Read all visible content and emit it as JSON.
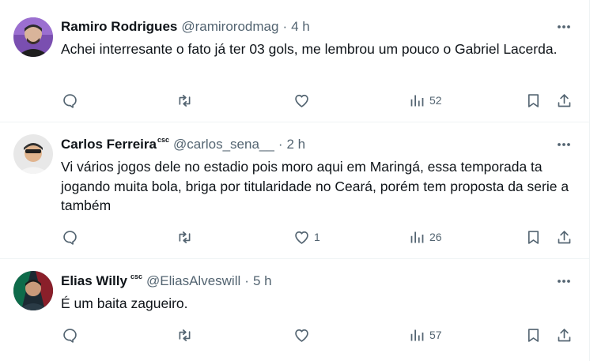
{
  "tweets": [
    {
      "name": "Ramiro Rodrigues",
      "badge": "",
      "handle": "@ramirorodmag",
      "separator": "·",
      "time": "4 h",
      "text": "Achei interresante o fato já ter 03 gols, me lembrou um pouco o Gabriel Lacerda.",
      "replies": "",
      "retweets": "",
      "likes": "",
      "views": "52"
    },
    {
      "name": "Carlos Ferreira",
      "badge": "csc",
      "handle": "@carlos_sena__",
      "separator": "·",
      "time": "2 h",
      "text": "Vi vários jogos dele no estadio pois moro aqui em Maringá, essa temporada ta jogando muita bola, briga por titularidade no Ceará, porém tem proposta da serie a também",
      "replies": "",
      "retweets": "",
      "likes": "1",
      "views": "26"
    },
    {
      "name": "Elias Willy",
      "badge": "csc",
      "handle": "@EliasAlveswill",
      "separator": "·",
      "time": "5 h",
      "text": "É um baita zagueiro.",
      "replies": "",
      "retweets": "",
      "likes": "",
      "views": "57"
    }
  ],
  "icons": {
    "more": "more-horizontal-icon",
    "reply": "reply-icon",
    "retweet": "retweet-icon",
    "like": "heart-icon",
    "views": "views-chart-icon",
    "bookmark": "bookmark-icon",
    "share": "share-icon"
  },
  "colors": {
    "text": "#0f1419",
    "secondary": "#536471",
    "border": "#eff3f4"
  }
}
